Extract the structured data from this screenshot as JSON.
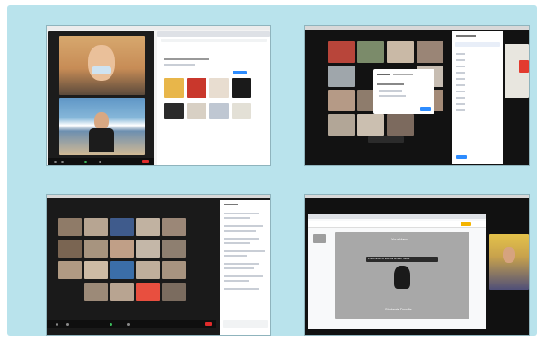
{
  "panels": {
    "top_left": {
      "name": "Zoom call with Google image search"
    },
    "top_right": {
      "name": "Zoom gallery view with breakout dialog"
    },
    "bottom_left": {
      "name": "Zoom gallery view with chat panel"
    },
    "bottom_right": {
      "name": "Zoom screen share of Google Slides"
    }
  },
  "colors": {
    "frame_bg": "#b9e3ec",
    "zoom_dark": "#1c1c1c",
    "end_button": "#e02b2b",
    "zoom_blue": "#2d8cff"
  },
  "icons": [
    "video-icon",
    "mic-icon",
    "share-icon",
    "chat-icon",
    "hand-icon"
  ],
  "slide": {
    "title": "Your Hand",
    "subtitle": "Students Doodle",
    "banner": "Press ESC to exit full screen mode"
  }
}
